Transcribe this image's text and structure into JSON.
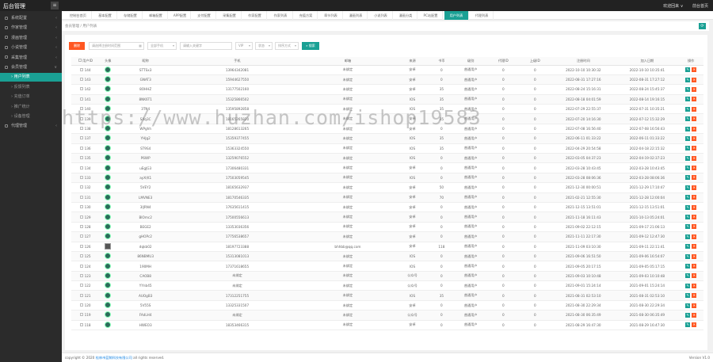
{
  "header": {
    "brand": "后台管理",
    "menu_icon": "≡",
    "user": "欢迎回来 ∨",
    "home_link": "前台首页"
  },
  "sidebar": {
    "items": [
      {
        "label": "系统配置",
        "chev": "‹"
      },
      {
        "label": "作家管理",
        "chev": "‹"
      },
      {
        "label": "漫画管理",
        "chev": "‹"
      },
      {
        "label": "小说管理",
        "chev": "‹"
      },
      {
        "label": "采集管理",
        "chev": "‹"
      },
      {
        "label": "会员管理",
        "chev": "∨"
      }
    ],
    "sub_items": [
      {
        "label": "用户列表"
      },
      {
        "label": "反馈列表"
      },
      {
        "label": "充值订单"
      },
      {
        "label": "推广统计"
      },
      {
        "label": "设备管理"
      }
    ],
    "last_item": {
      "label": "代理管理",
      "chev": "‹"
    }
  },
  "tabs": [
    "控制台首页",
    "基本配置",
    "存储配置",
    "邮箱配置",
    "APP配置",
    "支付配置",
    "采集配置",
    "作家配置",
    "作家列表",
    "充值方案",
    "章节列表",
    "漫画列表",
    "小说列表",
    "漫画分类",
    "PC站配置",
    "用户列表",
    "代理列表"
  ],
  "breadcrumb": "会员管理 / 用户列表",
  "refresh_icon": "⟳",
  "toolbar": {
    "delete_label": "删除",
    "date_placeholder": "请选择注册时间范围",
    "cal_icon": "▦",
    "device_select": "全部手机",
    "keyword_placeholder": "请输入关键字",
    "vip_select": "VIP",
    "status_select": "状态",
    "sort_select": "排序方式",
    "search_label": "搜索",
    "search_icon": "⌕",
    "dropdown_icon": "▾"
  },
  "table": {
    "headers": [
      "用户ID",
      "头像",
      "昵称",
      "手机",
      "邮箱",
      "来源",
      "书币",
      "级别",
      "代理ID",
      "上级ID",
      "注册时间",
      "加入日期",
      "操作"
    ],
    "rows": [
      [
        "144",
        "avatar",
        "STTSx3",
        "13964342081",
        "未绑定",
        "安卓",
        "0",
        "普通用户",
        "0",
        "0",
        "2022-10-10 10:30:32",
        "2022-10-10 10:35:41"
      ],
      [
        "143",
        "avatar",
        "GNAT3",
        "15944627550",
        "未绑定",
        "安卓",
        "0",
        "普通用户",
        "0",
        "0",
        "2022-08-31 17:27:16",
        "2022-08-31 17:27:12"
      ],
      [
        "142",
        "avatar",
        "8OHHZ",
        "13177502160",
        "未绑定",
        "安卓",
        "35",
        "普通用户",
        "0",
        "0",
        "2022-08-24 15:16:31",
        "2022-08-24 15:45:37"
      ],
      [
        "141",
        "avatar",
        "8NK6T1",
        "15325866502",
        "未绑定",
        "IOS",
        "35",
        "普通用户",
        "0",
        "0",
        "2022-08-18 04:01:59",
        "2022-08-14 19:16:15"
      ],
      [
        "140",
        "avatar",
        "3TN4",
        "13595892858",
        "未绑定",
        "IOS",
        "35",
        "普通用户",
        "0",
        "0",
        "2022-07-29 22:55:37",
        "2022-07-31 10:35:21"
      ],
      [
        "139",
        "avatar",
        "SXq3C",
        "18165265820",
        "未绑定",
        "安卓",
        "35",
        "普通用户",
        "0",
        "0",
        "2022-07-20 14:16:30",
        "2022-07-12 15:32:29"
      ],
      [
        "138",
        "avatar",
        "WPghh",
        "18128613265",
        "未绑定",
        "安卓",
        "0",
        "普通用户",
        "0",
        "0",
        "2022-07-08 16:56:40",
        "2022-07-08 16:56:43"
      ],
      [
        "137",
        "avatar",
        "YHJg2",
        "15359377455",
        "未绑定",
        "IOS",
        "35",
        "普通用户",
        "0",
        "0",
        "2022-06-11 01:33:22",
        "2022-06-11 01:33:22"
      ],
      [
        "136",
        "avatar",
        "ST9S4",
        "15363324550",
        "未绑定",
        "IOS",
        "35",
        "普通用户",
        "0",
        "0",
        "2022-04-29 20:54:58",
        "2022-04-18 22:15:32"
      ],
      [
        "135",
        "avatar",
        "P6WP",
        "13259076552",
        "未绑定",
        "IOS",
        "0",
        "普通用户",
        "0",
        "0",
        "2022-03-05 04:37:23",
        "2022-04-19 02:37:23"
      ],
      [
        "134",
        "avatar",
        "uEgJG3",
        "17306480331",
        "未绑定",
        "安卓",
        "0",
        "普通用户",
        "0",
        "0",
        "2022-03-28 10:43:45",
        "2022-03-28 10:43:45"
      ],
      [
        "133",
        "avatar",
        "ayX(K1",
        "17503059545",
        "未绑定",
        "IOS",
        "0",
        "普通用户",
        "0",
        "0",
        "2022-03-28 08:06:36",
        "2022-03-28 08:06:36"
      ],
      [
        "132",
        "avatar",
        "5VEY2",
        "18165632937",
        "未绑定",
        "安卓",
        "50",
        "普通用户",
        "0",
        "0",
        "2021-12-30 00:00:51",
        "2021-12-29 17:10:47"
      ],
      [
        "131",
        "avatar",
        "LMVNE3",
        "18170546335",
        "未绑定",
        "安卓",
        "70",
        "普通用户",
        "0",
        "0",
        "2021-02-21 12:55:30",
        "2021-12-28 12:00:04"
      ],
      [
        "130",
        "avatar",
        "3IJRN4",
        "17635611415",
        "未绑定",
        "安卓",
        "0",
        "普通用户",
        "0",
        "0",
        "2021-12-15 13:51:01",
        "2021-12-15 13:51:01"
      ],
      [
        "129",
        "avatar",
        "BIOmc2",
        "17500556613",
        "未绑定",
        "安卓",
        "0",
        "普通用户",
        "0",
        "0",
        "2021-11-18 16:11:43",
        "2021-10-13 05:24:01"
      ],
      [
        "128",
        "avatar",
        "BEGE2",
        "13353036356",
        "未绑定",
        "安卓",
        "0",
        "普通用户",
        "0",
        "0",
        "2021-09-02 22:12:15",
        "2021-09-17 21:06:13"
      ],
      [
        "127",
        "avatar",
        "gHOPc2",
        "17756538657",
        "未绑定",
        "安卓",
        "0",
        "普通用户",
        "0",
        "0",
        "2021-11-11 22:17:30",
        "2021-09-12 12:47:30"
      ],
      [
        "126",
        "qr",
        "dqkb02",
        "18197723388",
        "bhhbb@qq.com",
        "安卓",
        "118",
        "普通用户",
        "0",
        "0",
        "2021-11-09 03:10:30",
        "2021-09-11 22:11:41"
      ],
      [
        "125",
        "avatar",
        "86NBMU3",
        "15313081013",
        "未绑定",
        "IOS",
        "0",
        "普通用户",
        "0",
        "0",
        "2021-09-06 16:51:50",
        "2021-09-06 16:54:07"
      ],
      [
        "124",
        "avatar",
        "190MH",
        "17371618655",
        "未绑定",
        "IOS",
        "0",
        "普通用户",
        "0",
        "0",
        "2021-09-05 20:17:15",
        "2021-09-05 05:17:15"
      ],
      [
        "123",
        "avatar",
        "CAOB8",
        "未绑定",
        "未绑定",
        "公众号",
        "0",
        "普通用户",
        "0",
        "0",
        "2021-09-03 10:10:48",
        "2021-09-03 10:10:48"
      ],
      [
        "122",
        "avatar",
        "YYnb45",
        "未绑定",
        "未绑定",
        "公众号",
        "0",
        "普通用户",
        "0",
        "0",
        "2021-09-01 15:24:14",
        "2021-09-01 15:24:14"
      ],
      [
        "121",
        "avatar",
        "AUOgB3",
        "17312251755",
        "未绑定",
        "IOS",
        "35",
        "普通用户",
        "0",
        "0",
        "2021-08-31 02:53:10",
        "2021-08-31 02:53:10"
      ],
      [
        "120",
        "avatar",
        "5V55S",
        "13325331507",
        "未绑定",
        "安卓",
        "0",
        "普通用户",
        "0",
        "0",
        "2021-08-30 22:29:34",
        "2021-08-30 22:29:34"
      ],
      [
        "119",
        "avatar",
        "FAdLH4",
        "未绑定",
        "未绑定",
        "公众号",
        "0",
        "普通用户",
        "0",
        "0",
        "2021-08-30 06:35:49",
        "2021-08-30 06:35:49"
      ],
      [
        "118",
        "avatar",
        "HWEO3",
        "18353466315",
        "未绑定",
        "安卓",
        "0",
        "普通用户",
        "0",
        "0",
        "2021-08-29 16:47:30",
        "2021-08-29 16:47:30"
      ]
    ],
    "edit_icon": "✎",
    "delete_icon": "✕"
  },
  "footer": {
    "copyright_prefix": "copyright © 2020 ",
    "company": "桂林市蓝鲸科技有限公司",
    "copyright_suffix": " all rights reserved.",
    "version": "Version V1.0"
  },
  "watermark": "https://www.huzhan.com/ishop19583",
  "colors": {
    "accent": "#1aa094",
    "danger": "#ff5722",
    "sidebar": "#2b2b2b",
    "topbar": "#222222"
  }
}
